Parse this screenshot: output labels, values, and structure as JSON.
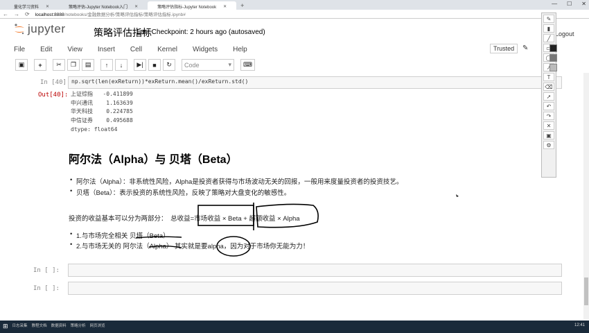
{
  "browser": {
    "tabs": [
      {
        "label": "量化学习资料"
      },
      {
        "label": "策略评估-Jupyter Notebook入门"
      },
      {
        "label": "策略评估指标-Jupyter Notebook"
      }
    ],
    "new_tab": "+",
    "url_host": "localhost",
    "url_port": ":8888",
    "url_path": "/notebooks/金融数据分析/策略评估指标/策略评估指标.ipynb#"
  },
  "jupyter": {
    "logo_text": "jupyter",
    "notebook_title": "策略评估指标",
    "checkpoint": "Last Checkpoint: 2 hours ago (autosaved)",
    "logout": "Logout",
    "menu": [
      "File",
      "Edit",
      "View",
      "Insert",
      "Cell",
      "Kernel",
      "Widgets",
      "Help"
    ],
    "trusted": "Trusted",
    "toolbar": {
      "cell_type": "Code"
    }
  },
  "cells": {
    "code40": {
      "prompt": "In [40]:",
      "source": "np.sqrt(len(exReturn))*exReturn.mean()/exReturn.std()"
    },
    "out40": {
      "prompt": "Out[40]:",
      "rows": [
        "上证综指   -0.411899",
        "中兴通讯    1.163639",
        "华天科技    0.224785",
        "中信证券    0.495688",
        "dtype: float64"
      ]
    },
    "markdown": {
      "heading": "阿尔法（Alpha）与 贝塔（Beta）",
      "bullets": [
        "阿尔法（Alpha）：非系统性风险，Alpha是投资者获得与市场波动无关的回报，一般用来度量投资者的投资技艺。",
        "贝塔（Beta）：表示投资的系统性风险，反映了策略对大盘变化的敏感性。"
      ],
      "para_prefix": "投资的收益基本可以分为两部分：",
      "formula_total": "总收益",
      "formula_eq": "=",
      "formula_market": "市场收益 × Beta",
      "formula_plus": "+",
      "formula_excess": "超额收益 × Alpha",
      "list1": "1.与市场完全相关  贝塔（Beta）",
      "list2_a": "2.与市场无关的",
      "list2_b": "阿尔法（Alpha）",
      "list2_c": "其实就是要",
      "list2_d": "alpha",
      "list2_e": "，因为对于市场你无能为力！"
    },
    "empty1": {
      "prompt": "In [ ]:"
    },
    "empty2": {
      "prompt": "In [ ]:"
    }
  },
  "taskbar": {
    "items": [
      "日志采集",
      "教程文档",
      "数据资料",
      "策略分析",
      "网页浏览"
    ],
    "clock": "12:41"
  }
}
